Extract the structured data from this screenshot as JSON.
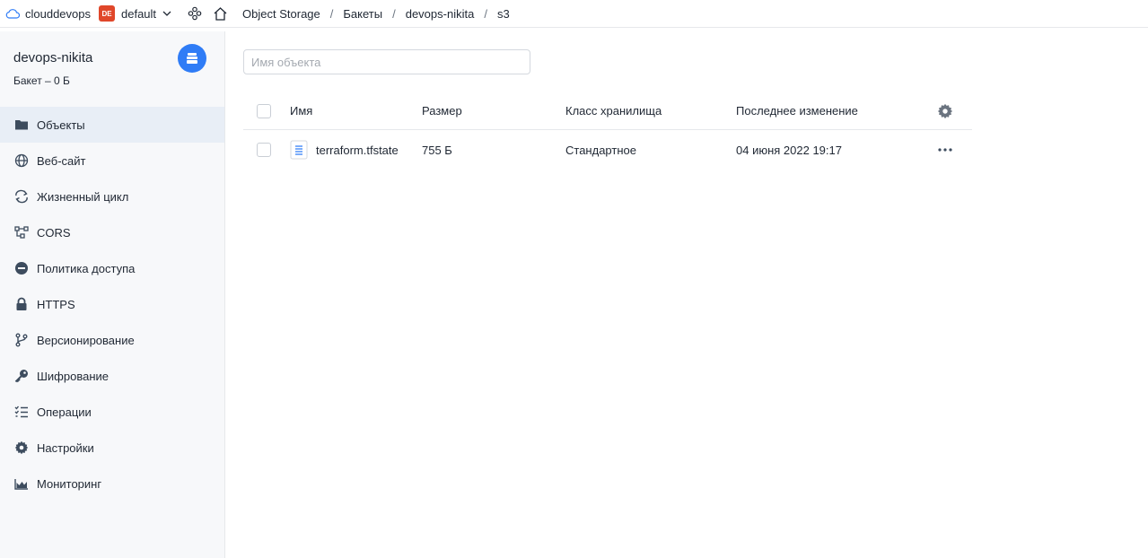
{
  "topbar": {
    "cloud_name": "clouddevops",
    "folder_badge": "DE",
    "folder_name": "default",
    "breadcrumbs": [
      "Object Storage",
      "Бакеты",
      "devops-nikita",
      "s3"
    ],
    "separator": "/"
  },
  "sidebar": {
    "title": "devops-nikita",
    "subtitle": "Бакет – 0 Б",
    "items": [
      {
        "label": "Объекты",
        "icon": "folder-icon",
        "active": true
      },
      {
        "label": "Веб-сайт",
        "icon": "globe-icon"
      },
      {
        "label": "Жизненный цикл",
        "icon": "cycle-icon"
      },
      {
        "label": "CORS",
        "icon": "cors-icon"
      },
      {
        "label": "Политика доступа",
        "icon": "minus-circle-icon"
      },
      {
        "label": "HTTPS",
        "icon": "lock-icon"
      },
      {
        "label": "Версионирование",
        "icon": "branch-icon"
      },
      {
        "label": "Шифрование",
        "icon": "key-icon"
      },
      {
        "label": "Операции",
        "icon": "checklist-icon"
      },
      {
        "label": "Настройки",
        "icon": "gear-icon"
      },
      {
        "label": "Мониторинг",
        "icon": "chart-icon"
      }
    ]
  },
  "search": {
    "placeholder": "Имя объекта"
  },
  "table": {
    "headers": {
      "name": "Имя",
      "size": "Размер",
      "class": "Класс хранилища",
      "modified": "Последнее изменение"
    },
    "rows": [
      {
        "name": "terraform.tfstate",
        "size": "755 Б",
        "class": "Стандартное",
        "modified": "04 июня 2022 19:17"
      }
    ]
  },
  "colors": {
    "accent": "#2f7cf6",
    "badge": "#e0472a",
    "icon": "#3d4c5e"
  }
}
